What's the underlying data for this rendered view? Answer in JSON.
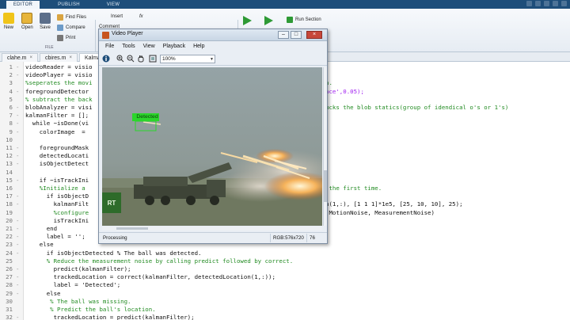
{
  "ribbon": {
    "tabs": [
      "EDITOR",
      "PUBLISH",
      "VIEW"
    ],
    "buttons": {
      "new": "New",
      "open": "Open",
      "save": "Save",
      "find_files": "Find Files",
      "compare": "Compare",
      "print": "Print",
      "insert": "Insert",
      "fx": "fx",
      "comment": "Comment",
      "run_section": "Run Section"
    },
    "group_file": "FILE"
  },
  "editor_tabs": [
    "clahe.m",
    "cbires.m",
    "Kalman"
  ],
  "lines": [
    {
      "n": "1",
      "code": "videoReader = visio",
      "mark": "-"
    },
    {
      "n": "2",
      "code": "videoPlayer = visio",
      "mark": "-"
    },
    {
      "n": "3",
      "code": "%seperates the movi",
      "mark": ""
    },
    {
      "n": "4",
      "code": "foregroundDetector ",
      "mark": "-"
    },
    {
      "n": "5",
      "code": "% subtract the back",
      "mark": ""
    },
    {
      "n": "6",
      "code": "blobAnalyzer = visi",
      "mark": "-"
    },
    {
      "n": "7",
      "code": "kalmanFilter = [];",
      "mark": "-"
    },
    {
      "n": "8",
      "code": "  while ~isDone(vi",
      "mark": "-"
    },
    {
      "n": "9",
      "code": "    colorImage  = ",
      "mark": "-"
    },
    {
      "n": "10",
      "code": "",
      "mark": ""
    },
    {
      "n": "11",
      "code": "    foregroundMask",
      "mark": "-"
    },
    {
      "n": "12",
      "code": "    detectedLocati",
      "mark": "-"
    },
    {
      "n": "13",
      "code": "    isObjectDetect",
      "mark": "-"
    },
    {
      "n": "14",
      "code": "",
      "mark": ""
    },
    {
      "n": "15",
      "code": "    if ~isTrackIni",
      "mark": "-"
    },
    {
      "n": "16",
      "code": "    %Initialize a ",
      "mark": ""
    },
    {
      "n": "17",
      "code": "      if isObjectD",
      "mark": "-"
    },
    {
      "n": "18",
      "code": "        kalmanFilt",
      "mark": "-"
    },
    {
      "n": "19",
      "code": "        %configure",
      "mark": ""
    },
    {
      "n": "20",
      "code": "        isTrackIni",
      "mark": "-"
    },
    {
      "n": "21",
      "code": "      end",
      "mark": "-"
    },
    {
      "n": "22",
      "code": "      label = '';",
      "mark": "-"
    },
    {
      "n": "23",
      "code": "    else",
      "mark": "-"
    },
    {
      "n": "24",
      "code": "      if isObjectDetected % The ball was detected.",
      "mark": "-"
    },
    {
      "n": "25",
      "code": "      % Reduce the measurement noise by calling predict followed by correct.",
      "mark": ""
    },
    {
      "n": "26",
      "code": "        predict(kalmanFilter);",
      "mark": "-"
    },
    {
      "n": "27",
      "code": "        trackedLocation = correct(kalmanFilter, detectedLocation(1,:));",
      "mark": "-"
    },
    {
      "n": "28",
      "code": "        label = 'Detected';",
      "mark": "-"
    },
    {
      "n": "29",
      "code": "      else",
      "mark": "-"
    },
    {
      "n": "30",
      "code": "       % The ball was missing.",
      "mark": ""
    },
    {
      "n": "31",
      "code": "       % Predict the ball's location.",
      "mark": ""
    },
    {
      "n": "32",
      "code": "        trackedLocation = predict(kalmanFilter);",
      "mark": "-"
    }
  ],
  "right_fragments": [
    {
      "line": 3,
      "text": "n."
    },
    {
      "line": 4,
      "text": "ace',0.05);"
    },
    {
      "line": 6,
      "text": "ucks the blob statics(group of idendical o's or 1's)"
    },
    {
      "line": 16,
      "text": " the first time."
    },
    {
      "line": 18,
      "text": "n(1,:), [1 1 1]*1e5, [25, 10, 10], 25);"
    },
    {
      "line": 19,
      "text": "(MotionNoise, MeasurementNoise)"
    }
  ],
  "video_player": {
    "title": "Video Player",
    "menu": [
      "File",
      "Tools",
      "View",
      "Playback",
      "Help"
    ],
    "zoom": "100%",
    "detected_label": "Detected",
    "watermark": "RT",
    "status": "Processing",
    "resolution": "RGB:576x720",
    "frame": "76"
  },
  "colors": {
    "ribbon_blue": "#1e4e7a",
    "comment_green": "#228b22",
    "string_purple": "#a020f0",
    "detected_box": "#2bd62b"
  }
}
